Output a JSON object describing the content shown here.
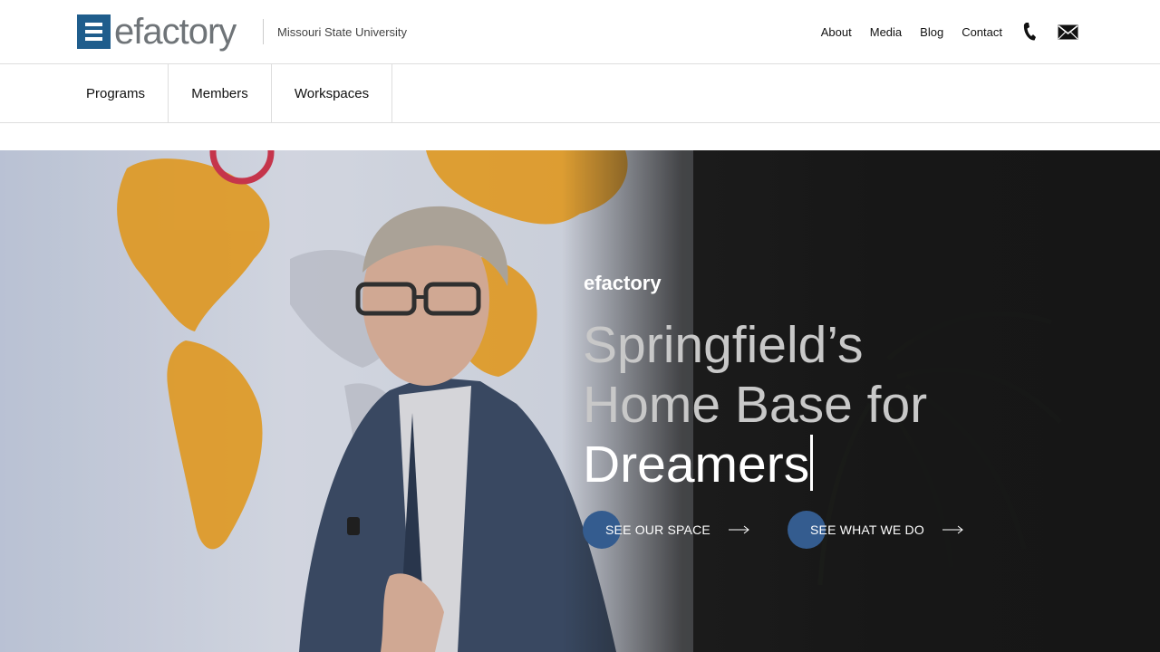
{
  "header": {
    "logo_text": "efactory",
    "university": "Missouri State University",
    "nav": [
      "About",
      "Media",
      "Blog",
      "Contact"
    ],
    "icons": [
      "phone-icon",
      "mail-icon"
    ]
  },
  "subnav": {
    "items": [
      "Programs",
      "Members",
      "Workspaces"
    ]
  },
  "hero": {
    "eyebrow": "efactory",
    "headline_line1": "Springfield’s",
    "headline_line2": "Home Base for",
    "headline_line3": "Dreamers",
    "cta_space": "SEE OUR SPACE",
    "cta_what": "SEE WHAT WE DO"
  },
  "colors": {
    "brand_blue": "#1f5d8c",
    "cta_circle": "#345c8f",
    "map_orange": "#f2a524"
  }
}
